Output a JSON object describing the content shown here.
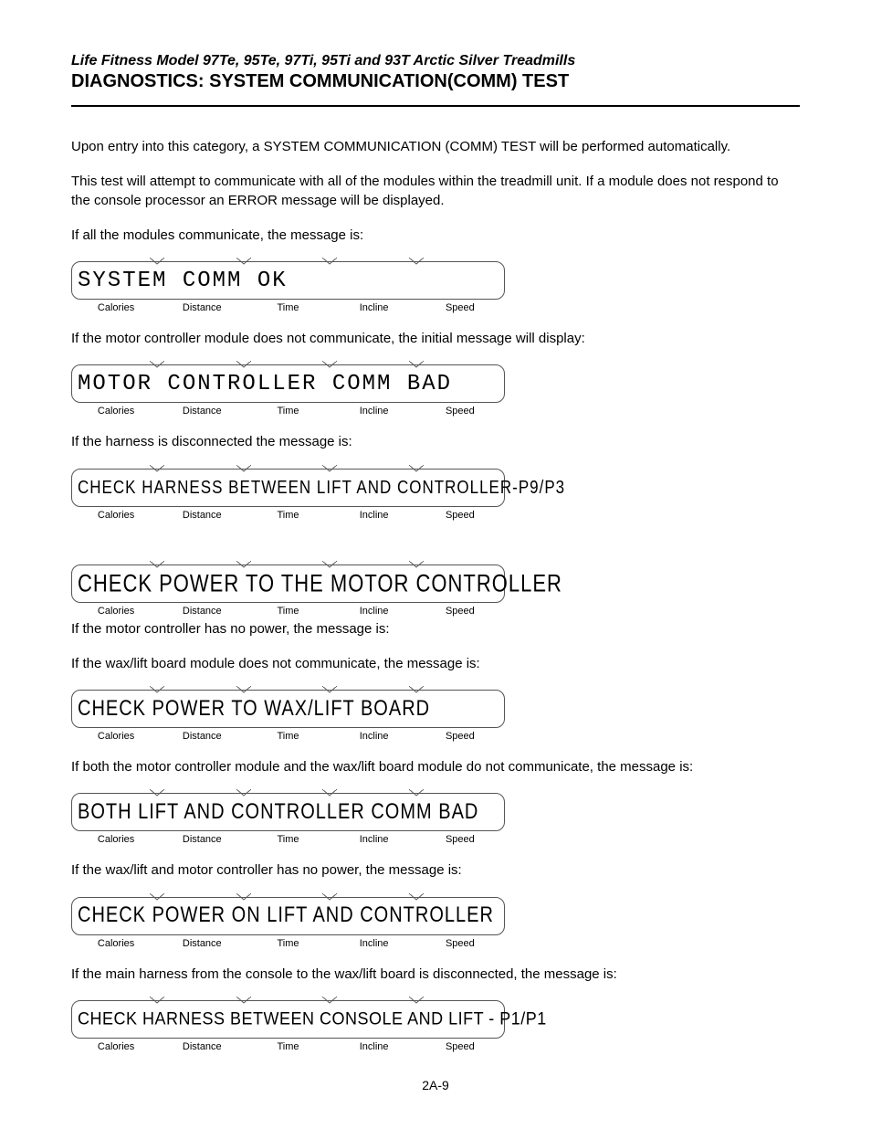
{
  "header": {
    "subtitle": "Life Fitness Model 97Te, 95Te, 97Ti, 95Ti and 93T Arctic Silver Treadmills",
    "title": "DIAGNOSTICS: SYSTEM COMMUNICATION(COMM) TEST"
  },
  "paragraphs": {
    "intro1": "Upon entry into this category, a SYSTEM COMMUNICATION (COMM) TEST will be performed automatically.",
    "intro2": "This test will attempt to communicate with all of the modules within the treadmill unit. If a module does not respond to the console processor an ERROR message will be displayed.",
    "p1": "If all the modules communicate, the message is:",
    "p2": "If the motor controller module does not communicate, the initial message will display:",
    "p3": "If the harness is disconnected the message is:",
    "p4": "If the motor controller has no power, the message is:",
    "p5": "If the wax/lift board module does not communicate, the message is:",
    "p6": "If both the motor controller module and the wax/lift board module do not communicate, the message is:",
    "p7": "If the wax/lift and motor controller has no power, the message is:",
    "p8": "If the main harness from the console to the wax/lift board is disconnected, the message is:"
  },
  "displays": {
    "d1": "SYSTEM COMM OK",
    "d2": "MOTOR CONTROLLER COMM BAD",
    "d3": "CHECK HARNESS BETWEEN LIFT AND CONTROLLER-P9/P3",
    "d4": "CHECK POWER TO THE MOTOR CONTROLLER",
    "d5": "CHECK POWER TO WAX/LIFT BOARD",
    "d6": "BOTH LIFT AND CONTROLLER COMM BAD",
    "d7": "CHECK POWER ON LIFT AND CONTROLLER",
    "d8": "CHECK HARNESS BETWEEN CONSOLE AND LIFT - P1/P1"
  },
  "labels": {
    "calories": "Calories",
    "distance": "Distance",
    "time": "Time",
    "incline": "Incline",
    "speed": "Speed"
  },
  "page_number": "2A-9"
}
